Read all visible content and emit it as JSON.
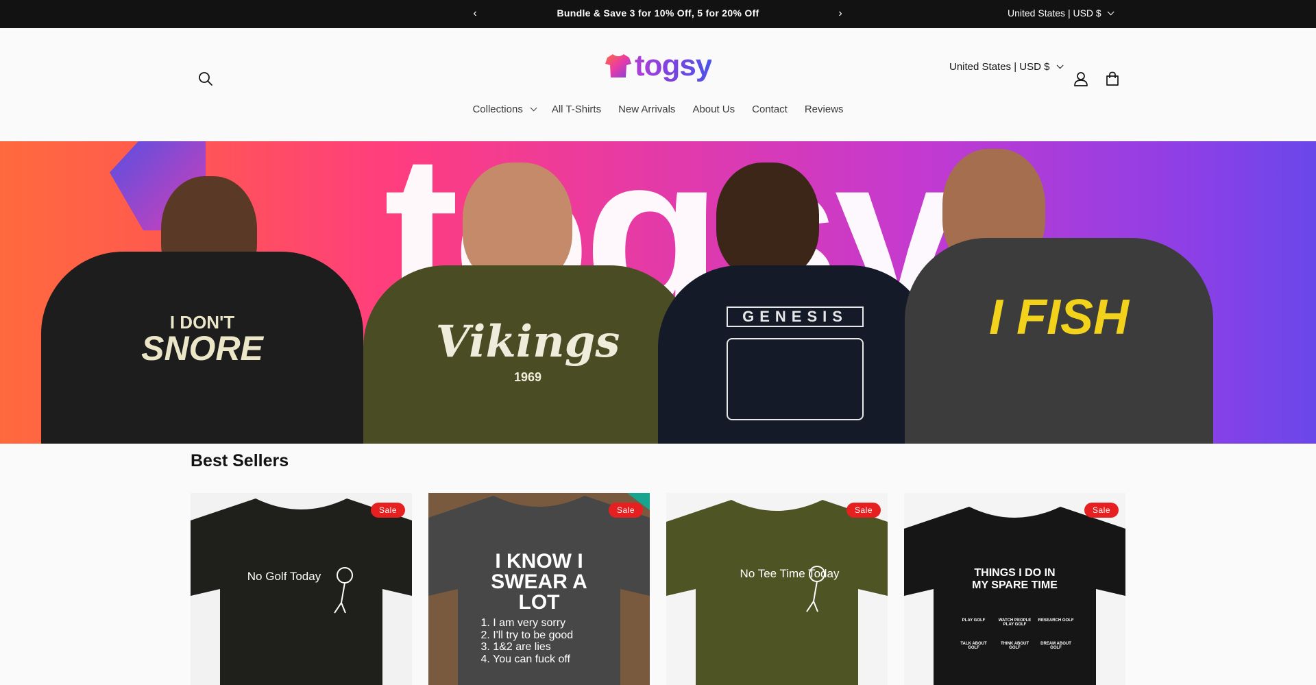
{
  "announcement": {
    "message": "Bundle & Save 3 for 10% Off, 5 for 20% Off",
    "prev_icon": "chevron-left-icon",
    "next_icon": "chevron-right-icon",
    "locale": "United States | USD $"
  },
  "header": {
    "brand": "togsy",
    "locale": "United States | USD $",
    "icons": {
      "search": "search-icon",
      "account": "user-icon",
      "cart": "cart-icon"
    }
  },
  "nav": {
    "items": [
      {
        "label": "Collections",
        "has_dropdown": true
      },
      {
        "label": "All T-Shirts"
      },
      {
        "label": "New Arrivals"
      },
      {
        "label": "About Us"
      },
      {
        "label": "Contact"
      },
      {
        "label": "Reviews"
      }
    ]
  },
  "hero": {
    "backdrop_text": "togsy",
    "shirts": [
      {
        "line1": "I DON'T",
        "line2": "SNORE"
      },
      {
        "line1": "Vikings",
        "line2": "1969"
      },
      {
        "line1": "GENESIS",
        "line2": ""
      },
      {
        "line1": "I FISH",
        "line2": ""
      }
    ]
  },
  "best_sellers": {
    "title": "Best Sellers",
    "products": [
      {
        "badge": "Sale",
        "shirt_color": "#1f1f1b",
        "print": "No Golf Today"
      },
      {
        "badge": "Sale",
        "shirt_color": "#474747",
        "print": "I KNOW I SWEAR A LOT",
        "list": [
          "1. I am very sorry",
          "2. I'll try to be good",
          "3. 1&2 are lies",
          "4. You can fuck off"
        ]
      },
      {
        "badge": "Sale",
        "shirt_color": "#4f5424",
        "print": "No Tee Time Today"
      },
      {
        "badge": "Sale",
        "shirt_color": "#161616",
        "print": "THINGS I DO IN MY SPARE TIME",
        "list": [
          "PLAY GOLF",
          "WATCH PEOPLE PLAY GOLF",
          "RESEARCH GOLF",
          "TALK ABOUT GOLF",
          "THINK ABOUT GOLF",
          "DREAM ABOUT GOLF"
        ]
      }
    ]
  },
  "colors": {
    "announcement_bg": "#121212",
    "sale_badge": "#e62020",
    "hero_gradient_start": "#ff6a3d",
    "hero_gradient_end": "#6a47ea"
  }
}
